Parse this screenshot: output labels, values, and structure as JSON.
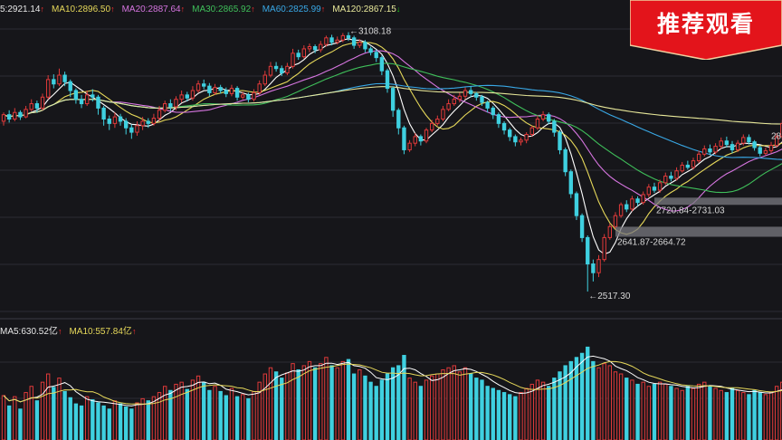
{
  "colors": {
    "background": "#16161a",
    "grid": "#2c2c34",
    "up": "#e03a3a",
    "down": "#3fd0e0",
    "ma5": "#ffffff",
    "ma10": "#e6d85a",
    "ma20": "#d675e0",
    "ma30": "#3fbf5a",
    "ma60": "#39a8e6",
    "ma120": "#e8e89a",
    "badge": "#e3141b"
  },
  "badge": {
    "label": "推荐观看"
  },
  "price_legend": [
    {
      "text": "5:2921.14",
      "arrow": "up",
      "color": "#e8e8e8"
    },
    {
      "text": "MA10:2896.50",
      "arrow": "up",
      "color": "#e6d85a"
    },
    {
      "text": "MA20:2887.64",
      "arrow": "up",
      "color": "#d675e0"
    },
    {
      "text": "MA30:2865.92",
      "arrow": "up",
      "color": "#3fbf5a"
    },
    {
      "text": "MA60:2825.99",
      "arrow": "up",
      "color": "#39a8e6"
    },
    {
      "text": "MA120:2867.15",
      "arrow": "down",
      "color": "#e8e89a"
    }
  ],
  "volume_legend": [
    {
      "text": "MA5:630.52亿",
      "arrow": "up",
      "color": "#e8e8e8"
    },
    {
      "text": "MA10:557.84亿",
      "arrow": "up",
      "color": "#e6d85a"
    }
  ],
  "chart_data": {
    "type": "candlestick",
    "title": "",
    "y_range": [
      2480,
      3140
    ],
    "annotations": [
      {
        "label": "←3108.18",
        "value": 3108.18,
        "index": 62
      },
      {
        "label": "2720.84-2731.03",
        "low": 2720.84,
        "high": 2731.03,
        "index": 117
      },
      {
        "label": "2641.87-2664.72",
        "low": 2641.87,
        "high": 2664.72,
        "index": 110
      },
      {
        "label": "←2517.30",
        "value": 2517.3,
        "index": 105
      }
    ],
    "right_edge_label": "28",
    "candles": [
      [
        2905,
        2920,
        2925,
        2895
      ],
      [
        2920,
        2910,
        2930,
        2902
      ],
      [
        2910,
        2925,
        2935,
        2905
      ],
      [
        2925,
        2915,
        2930,
        2908
      ],
      [
        2915,
        2932,
        2940,
        2912
      ],
      [
        2932,
        2945,
        2955,
        2928
      ],
      [
        2945,
        2935,
        2952,
        2925
      ],
      [
        2935,
        2960,
        2968,
        2930
      ],
      [
        2960,
        3000,
        3010,
        2955
      ],
      [
        3000,
        2990,
        3012,
        2980
      ],
      [
        2990,
        3010,
        3025,
        2985
      ],
      [
        3010,
        2995,
        3018,
        2985
      ],
      [
        2995,
        2975,
        3000,
        2960
      ],
      [
        2975,
        2955,
        2980,
        2945
      ],
      [
        2955,
        2945,
        2965,
        2935
      ],
      [
        2945,
        2965,
        2975,
        2940
      ],
      [
        2965,
        2960,
        2978,
        2950
      ],
      [
        2960,
        2935,
        2965,
        2920
      ],
      [
        2935,
        2910,
        2940,
        2895
      ],
      [
        2910,
        2900,
        2918,
        2885
      ],
      [
        2900,
        2915,
        2925,
        2890
      ],
      [
        2915,
        2905,
        2922,
        2895
      ],
      [
        2905,
        2890,
        2912,
        2875
      ],
      [
        2890,
        2880,
        2898,
        2865
      ],
      [
        2880,
        2895,
        2905,
        2872
      ],
      [
        2895,
        2905,
        2915,
        2885
      ],
      [
        2905,
        2900,
        2912,
        2890
      ],
      [
        2900,
        2912,
        2922,
        2895
      ],
      [
        2912,
        2930,
        2940,
        2905
      ],
      [
        2930,
        2945,
        2952,
        2925
      ],
      [
        2945,
        2938,
        2955,
        2928
      ],
      [
        2938,
        2955,
        2962,
        2930
      ],
      [
        2955,
        2965,
        2975,
        2948
      ],
      [
        2965,
        2958,
        2972,
        2950
      ],
      [
        2958,
        2975,
        2985,
        2952
      ],
      [
        2975,
        2990,
        2998,
        2970
      ],
      [
        2990,
        2985,
        3000,
        2978
      ],
      [
        2985,
        2970,
        2992,
        2962
      ],
      [
        2970,
        2982,
        2990,
        2965
      ],
      [
        2982,
        2975,
        2988,
        2968
      ],
      [
        2975,
        2968,
        2982,
        2960
      ],
      [
        2968,
        2980,
        2988,
        2962
      ],
      [
        2980,
        2960,
        2985,
        2952
      ],
      [
        2960,
        2965,
        2972,
        2955
      ],
      [
        2965,
        2955,
        2970,
        2948
      ],
      [
        2955,
        2970,
        2978,
        2950
      ],
      [
        2970,
        2990,
        2998,
        2965
      ],
      [
        2990,
        3010,
        3020,
        2985
      ],
      [
        3010,
        3030,
        3040,
        3005
      ],
      [
        3030,
        3025,
        3040,
        3018
      ],
      [
        3025,
        3015,
        3032,
        3008
      ],
      [
        3015,
        3030,
        3038,
        3010
      ],
      [
        3030,
        3060,
        3070,
        3025
      ],
      [
        3060,
        3052,
        3068,
        3045
      ],
      [
        3052,
        3070,
        3078,
        3048
      ],
      [
        3070,
        3075,
        3082,
        3062
      ],
      [
        3075,
        3068,
        3080,
        3060
      ],
      [
        3068,
        3080,
        3088,
        3062
      ],
      [
        3080,
        3095,
        3100,
        3075
      ],
      [
        3095,
        3085,
        3102,
        3078
      ],
      [
        3085,
        3090,
        3098,
        3080
      ],
      [
        3090,
        3100,
        3106,
        3085
      ],
      [
        3100,
        3095,
        3108,
        3088
      ],
      [
        3095,
        3078,
        3100,
        3070
      ],
      [
        3078,
        3085,
        3092,
        3072
      ],
      [
        3085,
        3070,
        3090,
        3062
      ],
      [
        3070,
        3062,
        3075,
        3055
      ],
      [
        3062,
        3050,
        3068,
        3040
      ],
      [
        3050,
        3020,
        3055,
        3010
      ],
      [
        3020,
        2980,
        3025,
        2970
      ],
      [
        2980,
        2930,
        2985,
        2915
      ],
      [
        2930,
        2890,
        2935,
        2875
      ],
      [
        2890,
        2840,
        2895,
        2830
      ],
      [
        2840,
        2855,
        2862,
        2835
      ],
      [
        2855,
        2870,
        2878,
        2848
      ],
      [
        2870,
        2860,
        2875,
        2850
      ],
      [
        2860,
        2885,
        2890,
        2855
      ],
      [
        2885,
        2900,
        2908,
        2880
      ],
      [
        2900,
        2910,
        2918,
        2895
      ],
      [
        2910,
        2932,
        2940,
        2905
      ],
      [
        2932,
        2945,
        2955,
        2928
      ],
      [
        2945,
        2955,
        2965,
        2940
      ],
      [
        2955,
        2962,
        2970,
        2948
      ],
      [
        2962,
        2975,
        2982,
        2955
      ],
      [
        2975,
        2968,
        2985,
        2960
      ],
      [
        2968,
        2960,
        2972,
        2952
      ],
      [
        2960,
        2948,
        2965,
        2940
      ],
      [
        2948,
        2935,
        2952,
        2925
      ],
      [
        2935,
        2920,
        2940,
        2910
      ],
      [
        2920,
        2900,
        2925,
        2890
      ],
      [
        2900,
        2885,
        2905,
        2875
      ],
      [
        2885,
        2870,
        2890,
        2860
      ],
      [
        2870,
        2858,
        2875,
        2848
      ],
      [
        2858,
        2862,
        2868,
        2850
      ],
      [
        2862,
        2875,
        2880,
        2855
      ],
      [
        2875,
        2890,
        2895,
        2870
      ],
      [
        2890,
        2910,
        2918,
        2885
      ],
      [
        2910,
        2920,
        2928,
        2905
      ],
      [
        2920,
        2905,
        2925,
        2898
      ],
      [
        2905,
        2880,
        2910,
        2870
      ],
      [
        2880,
        2840,
        2885,
        2830
      ],
      [
        2840,
        2790,
        2845,
        2780
      ],
      [
        2790,
        2740,
        2795,
        2730
      ],
      [
        2740,
        2690,
        2745,
        2680
      ],
      [
        2690,
        2640,
        2695,
        2630
      ],
      [
        2640,
        2580,
        2645,
        2517
      ],
      [
        2580,
        2560,
        2590,
        2540
      ],
      [
        2560,
        2590,
        2600,
        2550
      ],
      [
        2590,
        2640,
        2648,
        2585
      ],
      [
        2640,
        2665,
        2672,
        2635
      ],
      [
        2665,
        2690,
        2698,
        2660
      ],
      [
        2690,
        2715,
        2720,
        2685
      ],
      [
        2715,
        2705,
        2725,
        2698
      ],
      [
        2705,
        2728,
        2735,
        2700
      ],
      [
        2728,
        2720,
        2734,
        2712
      ],
      [
        2720,
        2738,
        2745,
        2715
      ],
      [
        2738,
        2755,
        2762,
        2732
      ],
      [
        2755,
        2748,
        2765,
        2742
      ],
      [
        2748,
        2765,
        2772,
        2742
      ],
      [
        2765,
        2780,
        2788,
        2760
      ],
      [
        2780,
        2775,
        2790,
        2768
      ],
      [
        2775,
        2792,
        2800,
        2770
      ],
      [
        2792,
        2805,
        2812,
        2788
      ],
      [
        2805,
        2800,
        2815,
        2795
      ],
      [
        2800,
        2815,
        2822,
        2795
      ],
      [
        2815,
        2830,
        2838,
        2810
      ],
      [
        2830,
        2842,
        2850,
        2825
      ],
      [
        2842,
        2835,
        2852,
        2828
      ],
      [
        2835,
        2848,
        2855,
        2830
      ],
      [
        2848,
        2860,
        2868,
        2842
      ],
      [
        2860,
        2852,
        2870,
        2845
      ],
      [
        2852,
        2840,
        2860,
        2832
      ],
      [
        2840,
        2855,
        2862,
        2835
      ],
      [
        2855,
        2868,
        2875,
        2850
      ],
      [
        2868,
        2858,
        2875,
        2852
      ],
      [
        2858,
        2845,
        2862,
        2838
      ],
      [
        2845,
        2832,
        2850,
        2825
      ],
      [
        2832,
        2838,
        2845,
        2828
      ],
      [
        2838,
        2850,
        2858,
        2832
      ],
      [
        2850,
        2870,
        2878,
        2845
      ],
      [
        2870,
        2900,
        2908,
        2865
      ]
    ],
    "volume_y_range": [
      0,
      1000
    ],
    "volume": [
      430,
      330,
      420,
      300,
      460,
      520,
      380,
      560,
      640,
      510,
      600,
      470,
      410,
      350,
      330,
      420,
      390,
      360,
      330,
      300,
      380,
      350,
      320,
      300,
      360,
      400,
      380,
      420,
      460,
      520,
      480,
      540,
      560,
      490,
      580,
      620,
      560,
      480,
      520,
      470,
      430,
      500,
      420,
      440,
      400,
      470,
      560,
      640,
      700,
      660,
      600,
      650,
      740,
      680,
      720,
      760,
      700,
      740,
      800,
      720,
      700,
      760,
      780,
      640,
      680,
      620,
      560,
      520,
      580,
      640,
      700,
      720,
      820,
      600,
      560,
      520,
      580,
      620,
      640,
      680,
      700,
      720,
      660,
      700,
      640,
      600,
      580,
      520,
      500,
      480,
      460,
      440,
      420,
      460,
      500,
      540,
      580,
      560,
      520,
      600,
      660,
      720,
      760,
      800,
      840,
      900,
      760,
      700,
      740,
      720,
      660,
      640,
      600,
      580,
      540,
      560,
      520,
      540,
      560,
      540,
      520,
      500,
      480,
      520,
      500,
      540,
      560,
      520,
      500,
      480,
      460,
      500,
      480,
      460,
      440,
      480,
      460,
      440,
      460,
      520,
      560
    ],
    "volume_direction": [
      "up",
      "dn",
      "up",
      "dn",
      "up",
      "up",
      "dn",
      "up",
      "up",
      "dn",
      "up",
      "dn",
      "dn",
      "dn",
      "dn",
      "up",
      "dn",
      "dn",
      "dn",
      "dn",
      "up",
      "dn",
      "dn",
      "dn",
      "up",
      "up",
      "dn",
      "up",
      "up",
      "up",
      "dn",
      "up",
      "up",
      "dn",
      "up",
      "up",
      "dn",
      "dn",
      "up",
      "dn",
      "dn",
      "up",
      "dn",
      "up",
      "dn",
      "up",
      "up",
      "up",
      "up",
      "dn",
      "dn",
      "up",
      "up",
      "dn",
      "up",
      "up",
      "dn",
      "up",
      "up",
      "dn",
      "up",
      "up",
      "dn",
      "dn",
      "up",
      "dn",
      "dn",
      "dn",
      "dn",
      "dn",
      "dn",
      "dn",
      "dn",
      "up",
      "up",
      "dn",
      "up",
      "up",
      "up",
      "up",
      "up",
      "up",
      "up",
      "up",
      "dn",
      "dn",
      "dn",
      "dn",
      "dn",
      "dn",
      "dn",
      "dn",
      "dn",
      "up",
      "up",
      "up",
      "up",
      "up",
      "dn",
      "dn",
      "dn",
      "dn",
      "dn",
      "dn",
      "dn",
      "dn",
      "dn",
      "up",
      "up",
      "up",
      "up",
      "up",
      "dn",
      "up",
      "dn",
      "up",
      "up",
      "dn",
      "up",
      "up",
      "dn",
      "up",
      "up",
      "dn",
      "up",
      "up",
      "up",
      "dn",
      "up",
      "up",
      "dn",
      "dn",
      "up",
      "up",
      "dn",
      "dn",
      "dn",
      "up",
      "up",
      "up",
      "up"
    ]
  }
}
